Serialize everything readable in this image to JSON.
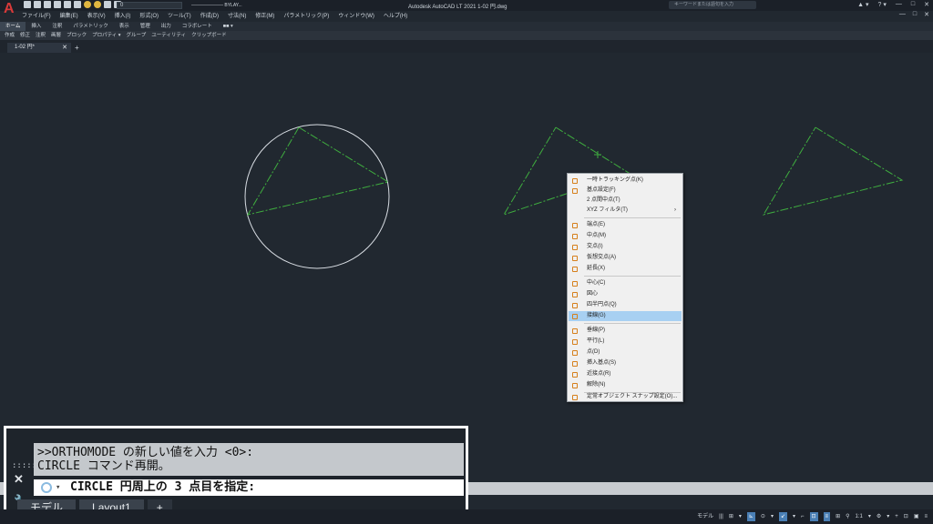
{
  "titlebar": {
    "app_title": "Autodesk AutoCAD LT 2021    1-02 円.dwg",
    "layer_value": "0",
    "linetype_value": "——————— BYLAY...",
    "search_placeholder": "キーワードまたは語句を入力",
    "right_icons": [
      "▲ ▾",
      "? ▾",
      "—",
      "□",
      "✕"
    ]
  },
  "menubar": {
    "items": [
      "ファイル(F)",
      "編集(E)",
      "表示(V)",
      "挿入(I)",
      "形式(O)",
      "ツール(T)",
      "作成(D)",
      "寸法(N)",
      "修正(M)",
      "パラメトリック(P)",
      "ウィンドウ(W)",
      "ヘルプ(H)"
    ],
    "win_controls": [
      "—",
      "□",
      "✕"
    ]
  },
  "ribbon": {
    "tabs": [
      "ホーム",
      "挿入",
      "注釈",
      "パラメトリック",
      "表示",
      "管理",
      "出力",
      "コラボレート",
      "■■ ▾"
    ],
    "panels": [
      "作成",
      "修正",
      "注釈",
      "画層",
      "ブロック",
      "プロパティ ▾",
      "グループ",
      "ユーティリティ",
      "クリップボード"
    ]
  },
  "document": {
    "tab_label": "1-02 円*",
    "close": "✕",
    "add": "+"
  },
  "context_menu": {
    "items": [
      {
        "label": "一時トラッキング点(K)",
        "icon": "tracking-icon"
      },
      {
        "label": "基点設定(F)",
        "icon": "from-icon"
      },
      {
        "label": "2 点間中点(T)",
        "icon": "none"
      },
      {
        "label": "XYZ フィルタ(T)",
        "icon": "none",
        "submenu": "›"
      },
      {
        "label": "端点(E)",
        "icon": "endpoint-icon"
      },
      {
        "label": "中点(M)",
        "icon": "midpoint-icon"
      },
      {
        "label": "交点(I)",
        "icon": "intersection-icon"
      },
      {
        "label": "仮想交点(A)",
        "icon": "apparent-intersection-icon"
      },
      {
        "label": "延長(X)",
        "icon": "extension-icon"
      },
      {
        "label": "中心(C)",
        "icon": "center-icon"
      },
      {
        "label": "図心",
        "icon": "centroid-icon"
      },
      {
        "label": "四半円点(Q)",
        "icon": "quadrant-icon"
      },
      {
        "label": "接線(G)",
        "icon": "tangent-icon",
        "highlighted": true
      },
      {
        "label": "垂線(P)",
        "icon": "perpendicular-icon"
      },
      {
        "label": "平行(L)",
        "icon": "parallel-icon"
      },
      {
        "label": "点(D)",
        "icon": "node-icon"
      },
      {
        "label": "挿入基点(S)",
        "icon": "insertion-icon"
      },
      {
        "label": "近接点(R)",
        "icon": "nearest-icon"
      },
      {
        "label": "解除(N)",
        "icon": "none-icon"
      },
      {
        "label": "定常オブジェクト スナップ設定(O)...",
        "icon": "osnap-settings-icon"
      }
    ]
  },
  "command": {
    "history_line1": ">>ORTHOMODE の新しい値を入力 <0>:",
    "history_line2": "CIRCLE コマンド再開。",
    "prompt": "CIRCLE 円周上の 3 点目を指定:",
    "handle": "::::::",
    "close": "✕",
    "customize": "🔧",
    "arrow": "▾"
  },
  "layout_tabs": [
    "モデル",
    "Layout1",
    "+"
  ],
  "statusbar": {
    "items": [
      "モデル",
      "|||",
      "⊞",
      "▾",
      "⊾",
      "⊙",
      "▾",
      "↙",
      "▾",
      "⌐",
      "⊡",
      "≡",
      "⊞",
      "⚲",
      "1:1",
      "▾",
      "⚙",
      "▾",
      "+",
      "⊡",
      "▣",
      "≡"
    ]
  },
  "colors": {
    "canvas": "#212830",
    "geometry_green": "#3fae3f",
    "circle": "#d8dde3",
    "highlight": "#a8d0f2"
  }
}
